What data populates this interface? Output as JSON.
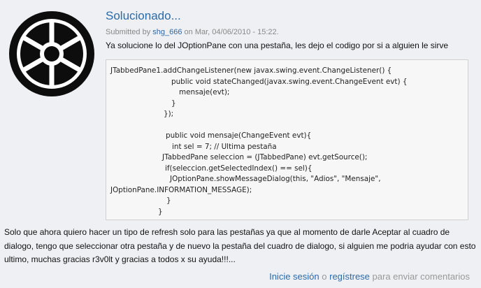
{
  "comment": {
    "title": "Solucionado...",
    "submitted_prefix": "Submitted by ",
    "author": "shg_666",
    "submitted_suffix": " on Mar, 04/06/2010 - 15:22.",
    "intro": "Ya solucione lo del JOptionPane con una pestaña, les dejo el codigo por si a alguien le sirve",
    "body": "Solo que ahora quiero hacer un tipo de refresh solo para las pestañas ya que al momento de darle Aceptar al cuadro de dialogo, tengo que seleccionar otra pestaña y de nuevo la pestaña del cuadro de dialogo, si alguien me podria ayudar con esto ultimo, muchas gracias r3v0lt y gracias a todos x su ayuda!!!..."
  },
  "code": {
    "line1": "JTabbedPane1.addChangeListener(new javax.swing.event.ChangeListener() {",
    "line2": "public void stateChanged(javax.swing.event.ChangeEvent evt) {",
    "line3": "mensaje(evt);",
    "line4": "}",
    "line5": "});",
    "line6": "public void mensaje(ChangeEvent evt){",
    "line7": "int sel = 7; // Ultima pestaña",
    "line8": "JTabbedPane seleccion = (JTabbedPane) evt.getSource();",
    "line9": "if(seleccion.getSelectedIndex() == sel){",
    "line10": "JOptionPane.showMessageDialog(this, \"Adios\", \"Mensaje\",",
    "line11": "JOptionPane.INFORMATION_MESSAGE);",
    "line12": "}",
    "line13": "}"
  },
  "links": {
    "login": "Inicie sesión",
    "or": " o ",
    "register": "regístrese",
    "suffix": " para enviar comentarios"
  },
  "colors": {
    "link": "#2a6aa8",
    "background": "#eef0f4"
  }
}
